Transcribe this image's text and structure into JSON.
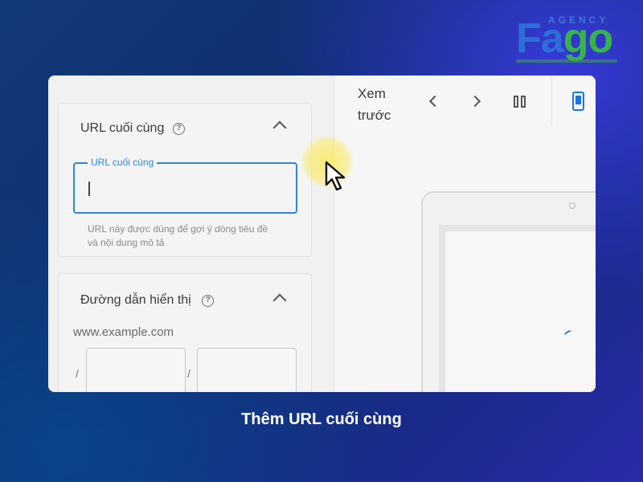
{
  "brand": {
    "name_part1": "Fa",
    "name_part2": "go",
    "subtitle": "AGENCY"
  },
  "final_url_panel": {
    "title": "URL cuối cùng",
    "field_label": "URL cuối cùng",
    "field_value": "",
    "hint": "URL này được dùng để gợi ý dòng tiêu đề và nội dung mô tả"
  },
  "display_path_panel": {
    "title": "Đường dẫn hiển thị",
    "domain": "www.example.com",
    "separator": "/",
    "path1_value": "",
    "path2_value": ""
  },
  "preview": {
    "title": "Xem trước"
  },
  "icons": {
    "help": "help-circle-icon",
    "collapse": "chevron-up-icon",
    "prev": "chevron-left-icon",
    "next": "chevron-right-icon",
    "split_view": "columns-icon",
    "device": "mobile-phone-icon",
    "cursor": "mouse-pointer-icon"
  },
  "colors": {
    "accent_blue": "#2f86d8",
    "brand_blue": "#2d6fd8",
    "brand_green": "#36b44a",
    "cursor_highlight": "#faeb6e"
  },
  "caption": "Thêm URL cuối cùng"
}
